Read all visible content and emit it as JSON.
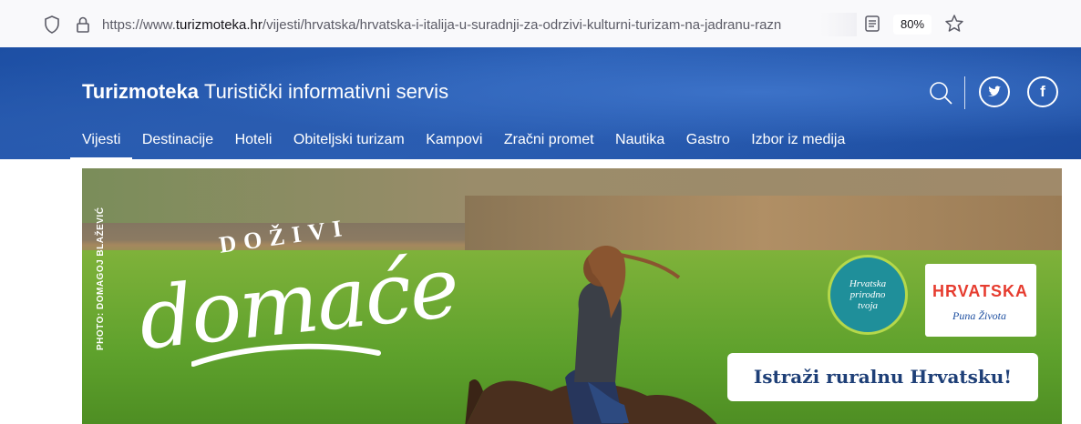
{
  "browser": {
    "url_prefix": "https://www.",
    "url_domain": "turizmoteka.hr",
    "url_path": "/vijesti/hrvatska/hrvatska-i-italija-u-suradnji-za-odrzivi-kulturni-turizam-na-jadranu-razn",
    "zoom": "80%",
    "icons": [
      "shield-icon",
      "lock-icon",
      "reader-view-icon",
      "bookmark-star-icon"
    ]
  },
  "header": {
    "brand_name": "Turizmoteka",
    "brand_tagline": "Turistički informativni servis",
    "social": {
      "twitter": "twitter-icon",
      "facebook": "f"
    }
  },
  "nav": {
    "items": [
      "Vijesti",
      "Destinacije",
      "Hoteli",
      "Obiteljski turizam",
      "Kampovi",
      "Zračni promet",
      "Nautika",
      "Gastro",
      "Izbor iz medija"
    ],
    "active": "Vijesti"
  },
  "banner": {
    "photo_credit": "PHOTO: DOMAGOJ BLAŽEVIĆ",
    "headline_small": "DOŽIVI",
    "headline_large": "domaće",
    "badge_line1": "Hrvatska",
    "badge_line2": "prirodno",
    "badge_line3": "tvoja",
    "logo_word": "HRVATSKA",
    "logo_tagline": "Puna Života",
    "cta": "Istraži ruralnu Hrvatsku!"
  },
  "colors": {
    "header_blue": "#2358ad",
    "cta_text": "#1e3f77",
    "logo_red": "#e63c2f"
  }
}
